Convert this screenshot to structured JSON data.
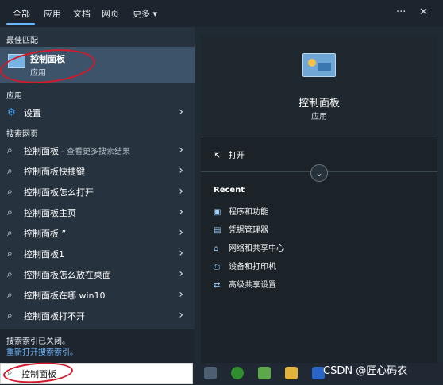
{
  "tabs": [
    {
      "label": "全部"
    },
    {
      "label": "应用"
    },
    {
      "label": "文档"
    },
    {
      "label": "网页"
    },
    {
      "label": "更多"
    }
  ],
  "top_actions": {
    "more_label": "···",
    "close_label": "✕"
  },
  "left": {
    "best_match_heading": "最佳匹配",
    "best_match_title": "控制面板",
    "best_match_sub": "应用",
    "apps_heading": "应用",
    "settings_label": "设置",
    "web_heading": "搜索网页",
    "web_results": [
      {
        "text": "控制面板",
        "sub": " - 查看更多搜索结果"
      },
      {
        "text": "控制面板快捷键",
        "sub": ""
      },
      {
        "text": "控制面板怎么打开",
        "sub": ""
      },
      {
        "text": "控制面板主页",
        "sub": ""
      },
      {
        "text": "控制面板 ”",
        "sub": ""
      },
      {
        "text": "控制面板1",
        "sub": ""
      },
      {
        "text": "控制面板怎么放在桌面",
        "sub": ""
      },
      {
        "text": "控制面板在哪 win10",
        "sub": ""
      },
      {
        "text": "控制面板打不开",
        "sub": ""
      }
    ],
    "index_notice": "搜索索引已关闭。",
    "index_link": "重新打开搜索索引。"
  },
  "right": {
    "title": "控制面板",
    "sub": "应用",
    "open_label": "打开",
    "recent_heading": "Recent",
    "recent_items": [
      {
        "label": "程序和功能"
      },
      {
        "label": "凭据管理器"
      },
      {
        "label": "网络和共享中心"
      },
      {
        "label": "设备和打印机"
      },
      {
        "label": "高级共享设置"
      }
    ]
  },
  "search": {
    "value": "控制面板"
  },
  "watermark": "CSDN @匠心码农"
}
